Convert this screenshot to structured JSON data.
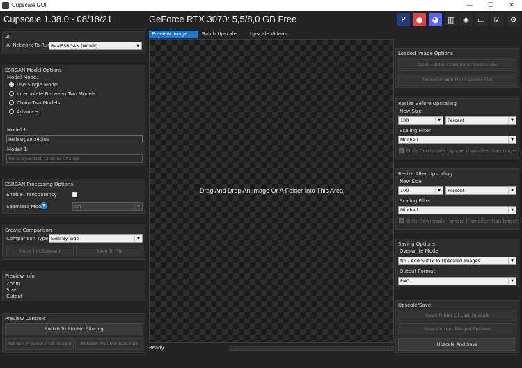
{
  "window": {
    "title": "Cupscale GUI"
  },
  "header": {
    "version": "Cupscale 1.38.0 - 08/18/21",
    "gpu": "GeForce RTX 3070: 5,5/8,0 GB Free"
  },
  "toolbar_icons": [
    {
      "name": "paypal-icon",
      "glyph": "P",
      "color": "#253b80"
    },
    {
      "name": "patreon-icon",
      "glyph": "●",
      "color": "#e8403e"
    },
    {
      "name": "discord-icon",
      "glyph": "◕",
      "color": "#5865f2"
    },
    {
      "name": "library-icon",
      "glyph": "▥",
      "color": "#2b2b2b"
    },
    {
      "name": "layers-icon",
      "glyph": "◈",
      "color": "#2b2b2b"
    },
    {
      "name": "folder-icon",
      "glyph": "▭",
      "color": "#2b2b2b"
    },
    {
      "name": "checklist-icon",
      "glyph": "☑",
      "color": "#2b2b2b"
    },
    {
      "name": "gear-icon",
      "glyph": "⚙",
      "color": "#2b2b2b"
    }
  ],
  "ai": {
    "title": "AI",
    "network_label": "AI Network To Run",
    "network_value": "RealESRGAN (NCNN)"
  },
  "esrgan": {
    "title": "ESRGAN Model Options",
    "mode_label": "Model Mode:",
    "modes": [
      "Use Single Model",
      "Interpolate Between Two Models",
      "Chain Two Models",
      "Advanced"
    ],
    "model1_label": "Model 1:",
    "model1_value": "realesrgan-x4plus",
    "model2_label": "Model 2:",
    "model2_value": "None Selected. Click To Change"
  },
  "processing": {
    "title": "ESRGAN Processing Options",
    "transparency_label": "Enable Transparency",
    "seamless_label": "Seamless Mode",
    "seamless_value": "Off",
    "help": "?"
  },
  "comparison": {
    "title": "Create Comparison",
    "type_label": "Comparison Type",
    "type_value": "Side By Side",
    "copy_btn": "Copy To Clipboard",
    "save_btn": "Save To File"
  },
  "preview_info": {
    "title": "Preview Info",
    "lines": [
      "Zoom",
      "Size",
      "Cutout"
    ]
  },
  "preview_controls": {
    "title": "Preview Controls",
    "switch_btn": "Switch To Bicubic Filtering",
    "refresh_full": "Refresh Preview (Full Image)",
    "refresh_cutout": "Refresh Preview (Cutout)"
  },
  "tabs": [
    "Preview Image",
    "Batch Upscale",
    "Upscale Videos"
  ],
  "canvas": {
    "drop_text": "Drag And Drop An Image Or A Folder Into This Area"
  },
  "status": {
    "text": "Ready."
  },
  "loaded_image": {
    "title": "Loaded Image Options",
    "open_folder": "Open Folder Containing Source File",
    "reload": "Reload Image From Source File"
  },
  "resize_before": {
    "title": "Resize Before Upscaling",
    "new_size_label": "New Size",
    "size_value": "100",
    "unit_value": "Percent",
    "filter_label": "Scaling Filter",
    "filter_value": "Mitchell",
    "downscale_label": "Only Downscale (Ignore if smaller than target)"
  },
  "resize_after": {
    "title": "Resize After Upscaling",
    "new_size_label": "New Size",
    "size_value": "100",
    "unit_value": "Percent",
    "filter_label": "Scaling Filter",
    "filter_value": "Mitchell",
    "downscale_label": "Only Downscale (Ignore if smaller than target)"
  },
  "saving": {
    "title": "Saving Options",
    "overwrite_label": "Overwrite Mode",
    "overwrite_value": "No - Add Suffix To Upscaled Images",
    "format_label": "Output Format",
    "format_value": "PNG"
  },
  "upscale_save": {
    "title": "Upscale/Save",
    "open_last": "Open Folder Of Last Upscale",
    "save_merged": "Save Current Merged Preview",
    "upscale_btn": "Upscale And Save"
  },
  "colors": {
    "accent": "#1e78d0",
    "background": "#232323",
    "panel": "#2d2d2d"
  }
}
